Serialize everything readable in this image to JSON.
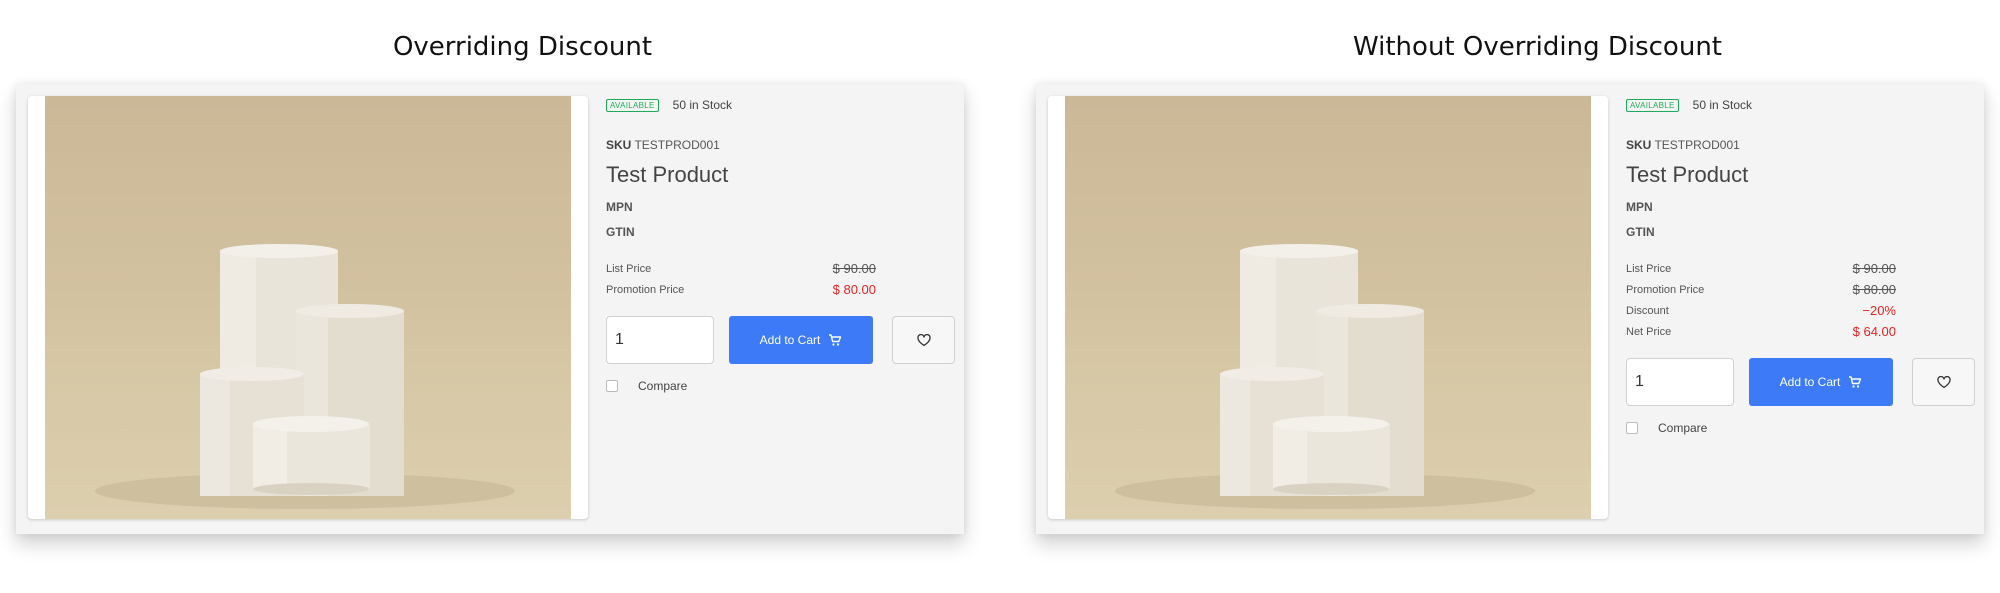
{
  "panels": [
    {
      "title": "Overriding Discount",
      "availability": "AVAILABLE",
      "stock": "50 in Stock",
      "sku_label": "SKU",
      "sku_value": "TESTPROD001",
      "product_name": "Test Product",
      "mpn_label": "MPN",
      "gtin_label": "GTIN",
      "prices": [
        {
          "label": "List Price",
          "value": "$ 90.00",
          "style": "strikethrough"
        },
        {
          "label": "Promotion Price",
          "value": "$ 80.00",
          "style": "red"
        }
      ],
      "quantity": "1",
      "add_to_cart": "Add to Cart",
      "compare": "Compare"
    },
    {
      "title": "Without Overriding Discount",
      "availability": "AVAILABLE",
      "stock": "50 in Stock",
      "sku_label": "SKU",
      "sku_value": "TESTPROD001",
      "product_name": "Test Product",
      "mpn_label": "MPN",
      "gtin_label": "GTIN",
      "prices": [
        {
          "label": "List Price",
          "value": "$ 90.00",
          "style": "strikethrough"
        },
        {
          "label": "Promotion Price",
          "value": "$ 80.00",
          "style": "strikethrough"
        },
        {
          "label": "Discount",
          "value": "−20%",
          "style": "red"
        },
        {
          "label": "Net Price",
          "value": "$ 64.00",
          "style": "red"
        }
      ],
      "quantity": "1",
      "add_to_cart": "Add to Cart",
      "compare": "Compare"
    }
  ],
  "colors": {
    "accent_button": "#3d7af7",
    "available_badge": "#1faa5a",
    "discount_red": "#e02424",
    "panel_background": "#f4f4f4"
  },
  "icons": [
    "shopping-cart-icon",
    "heart-icon"
  ]
}
